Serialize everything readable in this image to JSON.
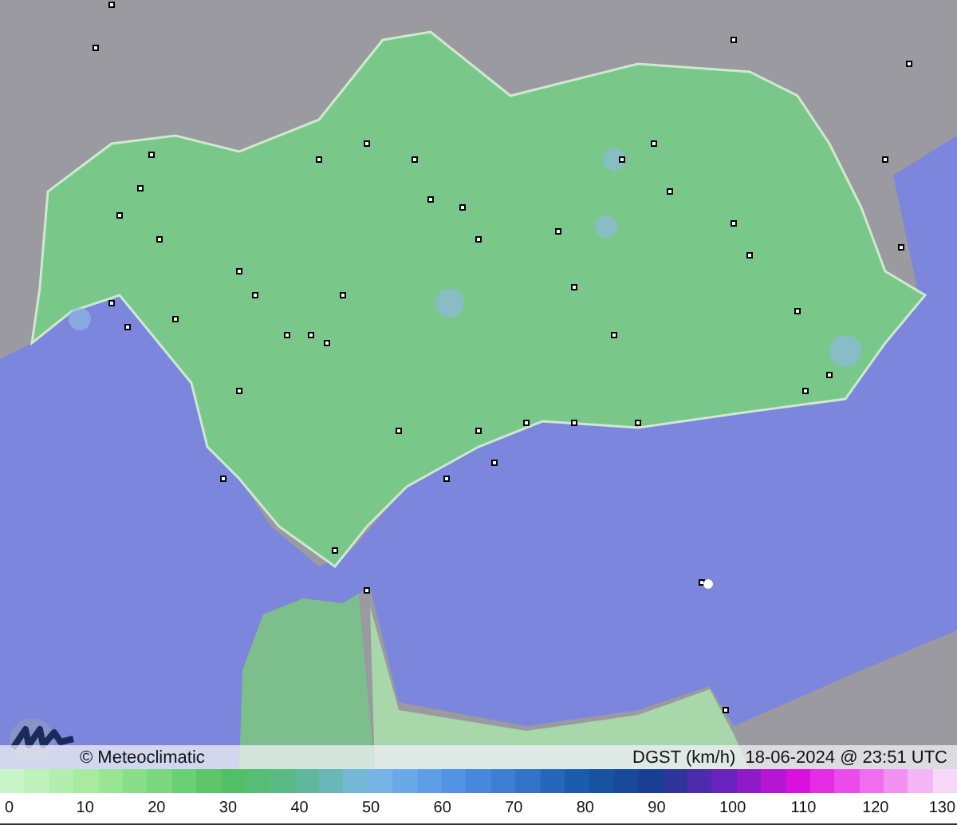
{
  "caption": {
    "credit": "© Meteoclimatic",
    "variable": "DGST (km/h)",
    "timestamp": "18-06-2024 @ 23:51 UTC"
  },
  "scale": {
    "labels": [
      "0",
      "10",
      "20",
      "30",
      "40",
      "50",
      "60",
      "70",
      "80",
      "90",
      "100",
      "110",
      "120",
      "130"
    ]
  }
}
